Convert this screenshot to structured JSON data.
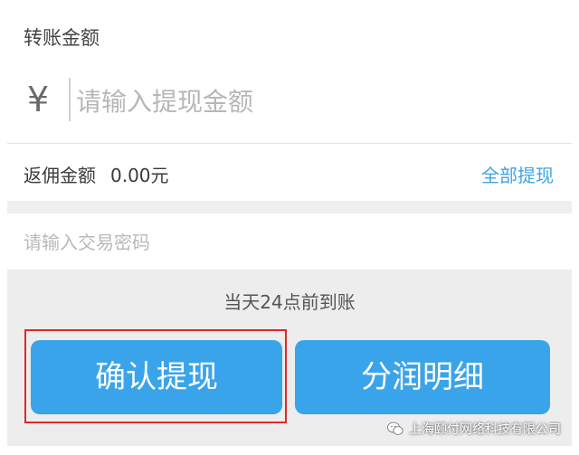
{
  "amount_section": {
    "label": "转账金额",
    "currency_symbol": "¥",
    "input_placeholder": "请输入提现金额"
  },
  "rebate": {
    "label": "返佣金额",
    "value": "0.00元",
    "withdraw_all_label": "全部提现"
  },
  "password": {
    "placeholder": "请输入交易密码"
  },
  "arrival_note": "当天24点前到账",
  "buttons": {
    "confirm_label": "确认提现",
    "detail_label": "分润明细"
  },
  "watermark": {
    "icon": "wechat-icon",
    "text": "上海颐付网络科技有限公司"
  },
  "colors": {
    "accent": "#3aa4ea",
    "link": "#3ea4e6",
    "highlight": "#e0282b",
    "panel_bg": "#ededed"
  }
}
